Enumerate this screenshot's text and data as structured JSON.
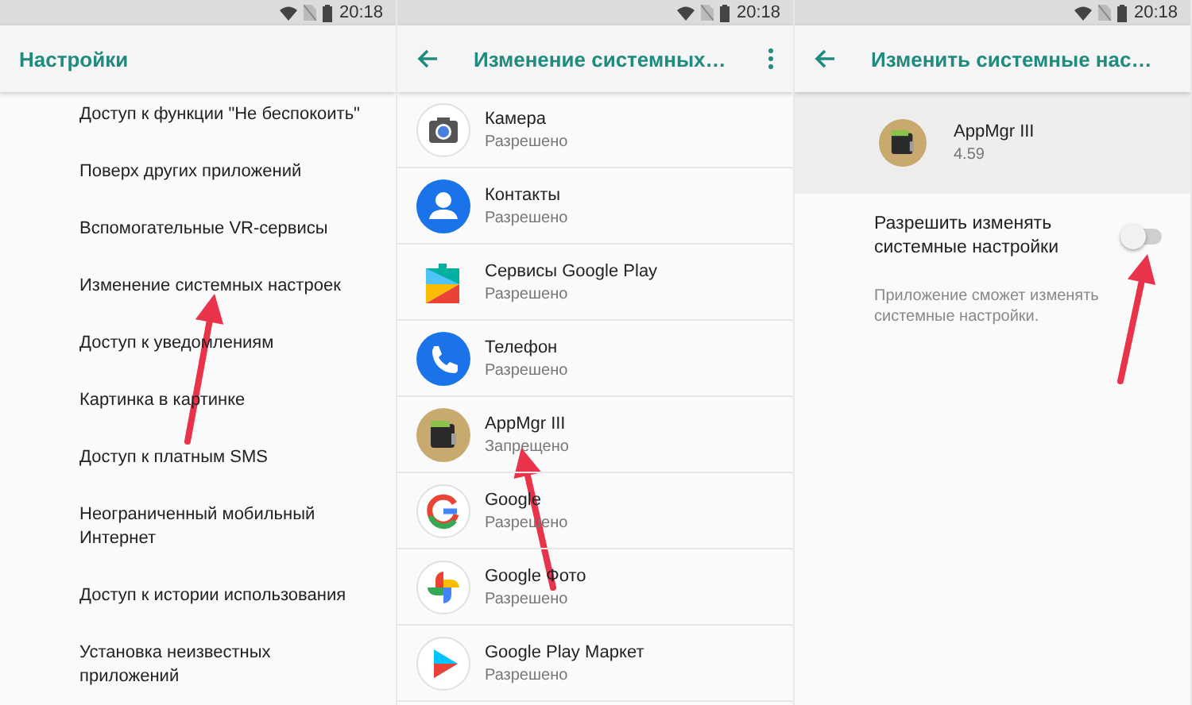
{
  "screens": [
    {
      "kind": "settings_list",
      "status_bar": {
        "time": "20:18"
      },
      "app_bar": {
        "title": "Настройки",
        "back": false,
        "menu": false
      },
      "arrow": true,
      "items": [
        {
          "label": "Доступ к функции \"Не беспокоить\""
        },
        {
          "label": "Поверх других приложений"
        },
        {
          "label": "Вспомогательные VR-сервисы"
        },
        {
          "label": "Изменение системных настроек"
        },
        {
          "label": "Доступ к уведомлениям"
        },
        {
          "label": "Картинка в картинке"
        },
        {
          "label": "Доступ к платным SMS"
        },
        {
          "label": "Неограниченный мобильный Интернет"
        },
        {
          "label": "Доступ к истории использования"
        },
        {
          "label": "Установка неизвестных приложений"
        }
      ]
    },
    {
      "kind": "app_list",
      "status_bar": {
        "time": "20:18"
      },
      "app_bar": {
        "title": "Изменение системных…",
        "back": true,
        "menu": true
      },
      "arrow": true,
      "apps": [
        {
          "name": "Камера",
          "status": "Разрешено"
        },
        {
          "name": "Контакты",
          "status": "Разрешено"
        },
        {
          "name": "Сервисы Google Play",
          "status": "Разрешено"
        },
        {
          "name": "Телефон",
          "status": "Разрешено"
        },
        {
          "name": "AppMgr III",
          "status": "Запрещено"
        },
        {
          "name": "Google",
          "status": "Разрешено"
        },
        {
          "name": "Google Фото",
          "status": "Разрешено"
        },
        {
          "name": "Google Play Маркет",
          "status": "Разрешено"
        }
      ]
    },
    {
      "kind": "app_detail",
      "status_bar": {
        "time": "20:18"
      },
      "app_bar": {
        "title": "Изменить системные нас…",
        "back": true,
        "menu": false
      },
      "arrow": true,
      "app": {
        "name": "AppMgr III",
        "version": "4.59"
      },
      "setting": {
        "title": "Разрешить изменять системные настройки",
        "on": false
      },
      "description": "Приложение сможет изменять системные настройки."
    }
  ]
}
